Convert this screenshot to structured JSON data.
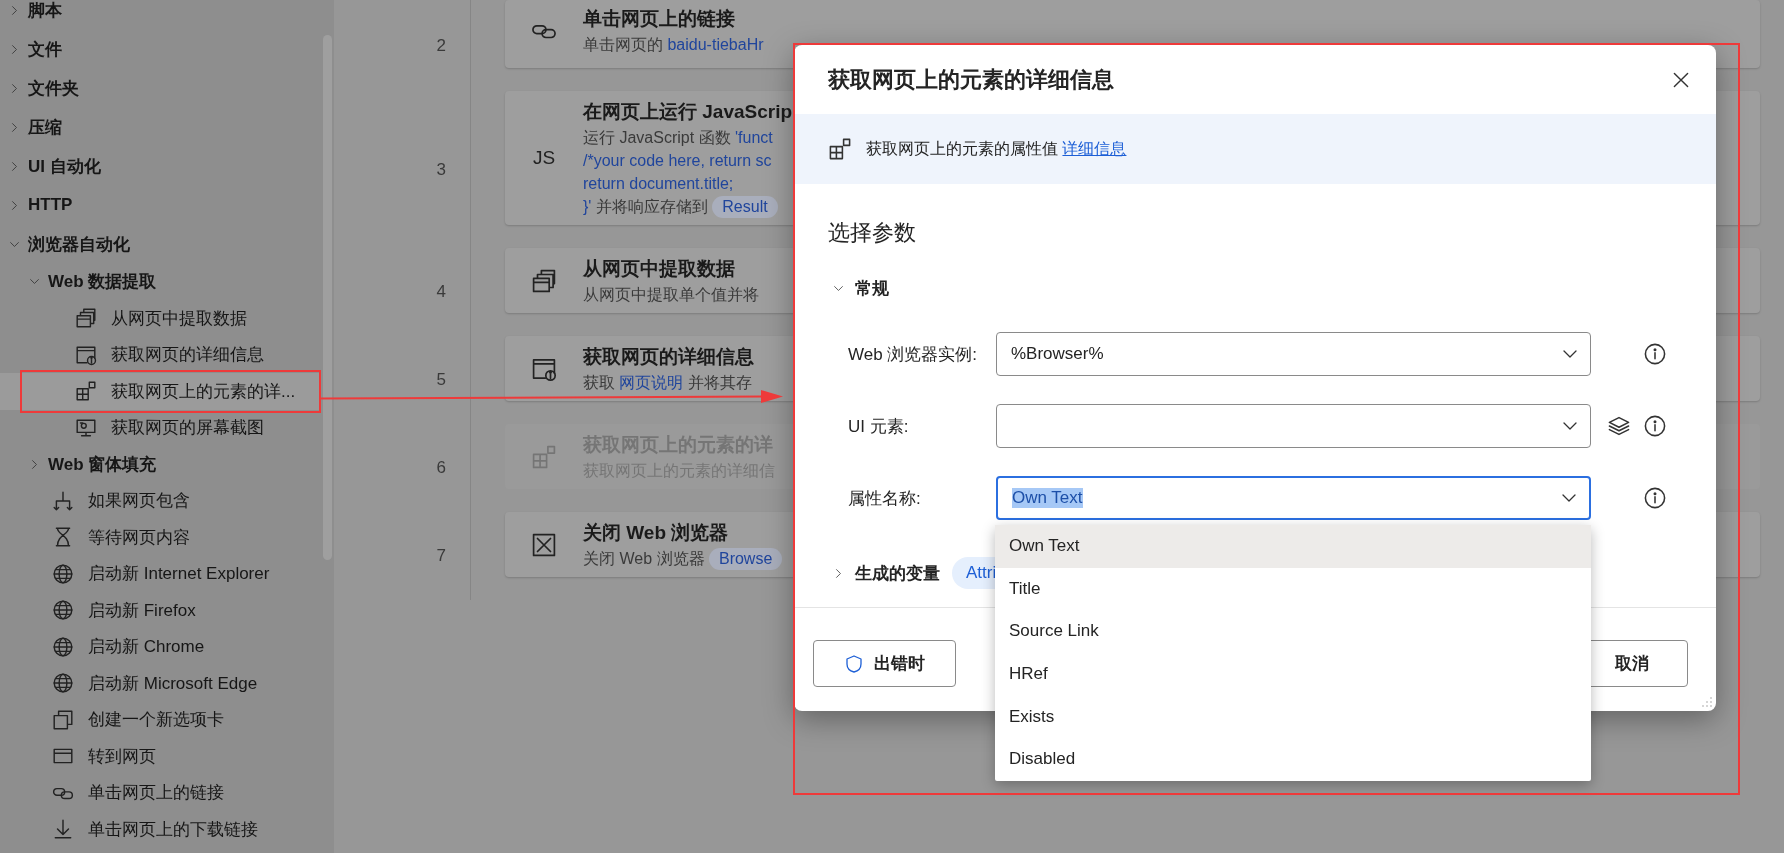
{
  "sidebar": {
    "items": [
      {
        "kind": "group",
        "label": "脚本",
        "expanded": false
      },
      {
        "kind": "group",
        "label": "文件",
        "expanded": false
      },
      {
        "kind": "group",
        "label": "文件夹",
        "expanded": false
      },
      {
        "kind": "group",
        "label": "压缩",
        "expanded": false
      },
      {
        "kind": "group",
        "label": "UI 自动化",
        "expanded": false
      },
      {
        "kind": "group",
        "label": "HTTP",
        "expanded": false
      },
      {
        "kind": "group",
        "label": "浏览器自动化",
        "expanded": true,
        "children": [
          {
            "kind": "group",
            "label": "Web 数据提取",
            "expanded": true,
            "children": [
              {
                "kind": "action",
                "label": "从网页中提取数据",
                "selected": false
              },
              {
                "kind": "action",
                "label": "获取网页的详细信息",
                "selected": false
              },
              {
                "kind": "action",
                "label": "获取网页上的元素的详...",
                "selected": true
              },
              {
                "kind": "action",
                "label": "获取网页的屏幕截图",
                "selected": false
              }
            ]
          },
          {
            "kind": "group",
            "label": "Web 窗体填充",
            "expanded": false
          },
          {
            "kind": "action",
            "label": "如果网页包含",
            "selected": false
          },
          {
            "kind": "action",
            "label": "等待网页内容",
            "selected": false
          },
          {
            "kind": "action",
            "label": "启动新 Internet Explorer",
            "selected": false
          },
          {
            "kind": "action",
            "label": "启动新 Firefox",
            "selected": false
          },
          {
            "kind": "action",
            "label": "启动新 Chrome",
            "selected": false
          },
          {
            "kind": "action",
            "label": "启动新 Microsoft Edge",
            "selected": false
          },
          {
            "kind": "action",
            "label": "创建一个新选项卡",
            "selected": false
          },
          {
            "kind": "action",
            "label": "转到网页",
            "selected": false
          },
          {
            "kind": "action",
            "label": "单击网页上的链接",
            "selected": false
          },
          {
            "kind": "action",
            "label": "单击网页上的下载链接",
            "selected": false
          }
        ]
      }
    ]
  },
  "flow": {
    "steps": [
      {
        "number": "2",
        "title": "单击网页上的链接",
        "disabled": false,
        "lines": [
          [
            {
              "kind": "text",
              "text": "单击网页的"
            },
            {
              "kind": "value",
              "text": "baidu-tiebaHr"
            }
          ]
        ]
      },
      {
        "number": "3",
        "badge": "JS",
        "title": "在网页上运行 JavaScrip",
        "disabled": false,
        "lines": [
          [
            {
              "kind": "text",
              "text": "运行 JavaScript 函数"
            },
            {
              "kind": "value",
              "text": "'funct"
            }
          ],
          [
            {
              "kind": "value",
              "text": "/*your code here, return sc"
            }
          ],
          [
            {
              "kind": "value",
              "text": "return document.title;"
            }
          ],
          [
            {
              "kind": "value",
              "text": "}'"
            },
            {
              "kind": "text",
              "text": "并将响应存储到"
            },
            {
              "kind": "token",
              "text": "Result"
            }
          ]
        ]
      },
      {
        "number": "4",
        "title": "从网页中提取数据",
        "disabled": false,
        "lines": [
          [
            {
              "kind": "text",
              "text": "从网页中提取单个值并将"
            }
          ]
        ]
      },
      {
        "number": "5",
        "title": "获取网页的详细信息",
        "disabled": false,
        "lines": [
          [
            {
              "kind": "text",
              "text": "获取"
            },
            {
              "kind": "value",
              "text": "网页说明"
            },
            {
              "kind": "text",
              "text": "并将其存"
            }
          ]
        ]
      },
      {
        "number": "6",
        "title": "获取网页上的元素的详",
        "disabled": true,
        "lines": [
          [
            {
              "kind": "text",
              "text": "获取网页上的元素的详细信"
            }
          ]
        ]
      },
      {
        "number": "7",
        "title": "关闭 Web 浏览器",
        "disabled": false,
        "lines": [
          [
            {
              "kind": "text",
              "text": "关闭 Web 浏览器"
            },
            {
              "kind": "token",
              "text": "Browse"
            }
          ]
        ]
      }
    ]
  },
  "dialog": {
    "title": "获取网页上的元素的详细信息",
    "info": {
      "text": "获取网页上的元素的属性值",
      "link": "详细信息"
    },
    "section_title": "选择参数",
    "group": {
      "label": "常规",
      "expanded": true
    },
    "fields": [
      {
        "kind": "dropdown",
        "label": "Web 浏览器实例:",
        "value": "%Browser%",
        "focused": false
      },
      {
        "kind": "picker",
        "label": "UI 元素:",
        "focused": false
      },
      {
        "kind": "dropdown",
        "label": "属性名称:",
        "value": "Own Text",
        "focused": true
      }
    ],
    "output": {
      "label": "生成的变量",
      "expanded": false,
      "variables": [
        "Attri"
      ]
    },
    "buttons": [
      {
        "kind": "error",
        "label": "出错时"
      },
      {
        "kind": "cancel",
        "label": "取消"
      }
    ],
    "dropdown": {
      "options": [
        {
          "label": "Own Text",
          "selected": true
        },
        {
          "label": "Title",
          "selected": false
        },
        {
          "label": "Source Link",
          "selected": false
        },
        {
          "label": "HRef",
          "selected": false
        },
        {
          "label": "Exists",
          "selected": false
        },
        {
          "label": "Disabled",
          "selected": false
        }
      ]
    }
  }
}
